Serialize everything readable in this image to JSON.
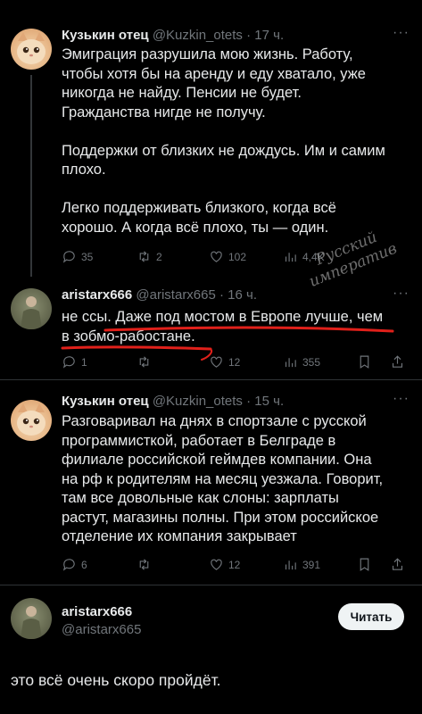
{
  "tweet1": {
    "name": "Кузькин отец",
    "handle": "@Kuzkin_otets",
    "time": "· 17 ч.",
    "text": "Эмиграция разрушила мою жизнь. Работу,\nчтобы хотя бы на аренду и еду хватало, уже\nникогда не найду. Пенсии не будет.\nГражданства нигде не получу.\n\nПоддержки от близких не дождусь. Им и самим\nплохо.\n\nЛегко поддерживать близкого, когда всё\nхорошо. А когда всё плохо, ты — один.",
    "replies": "35",
    "retweets": "2",
    "likes": "102",
    "views": "4,4K"
  },
  "watermark": {
    "line1": "Русский",
    "line2": "императив"
  },
  "tweet2": {
    "name": "aristarx666",
    "handle": "@aristarx665",
    "time": "· 16 ч.",
    "text": "не ссы. Даже под мостом в Европе лучше, чем\nв зобмо-рабостане.",
    "replies": "1",
    "retweets": "",
    "likes": "12",
    "views": "355",
    "underline_color": "#e0201a"
  },
  "tweet3": {
    "name": "Кузькин отец",
    "handle": "@Kuzkin_otets",
    "time": "· 15 ч.",
    "text": "Разговаривал на днях в спортзале с русской\nпрограммисткой, работает в Белграде в\nфилиале российской геймдев компании. Она\nна рф к родителям на месяц уезжала. Говорит,\nтам все довольные как слоны: зарплаты\nрастут, магазины полны. При этом российское\nотделение их компания закрывает",
    "replies": "6",
    "retweets": "",
    "likes": "12",
    "views": "391"
  },
  "main": {
    "name": "aristarx666",
    "handle": "@aristarx665",
    "read_label": "Читать",
    "text": "это всё очень скоро пройдёт."
  },
  "icons": [
    "reply-icon",
    "retweet-icon",
    "like-icon",
    "views-icon",
    "bookmark-icon",
    "share-icon",
    "more-icon"
  ]
}
